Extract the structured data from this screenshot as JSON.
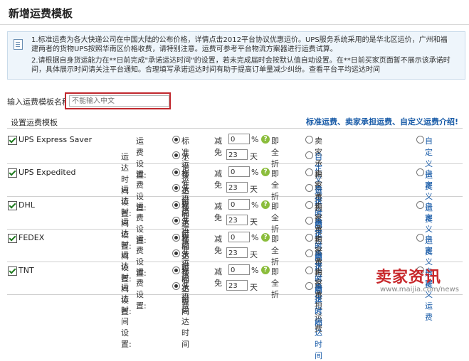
{
  "header": {
    "title": "新增运费模板"
  },
  "notice": {
    "line1": "1.标准运费为各大快递公司在中国大陆的公布价格，详情点击2012平台协议优惠运价。UPS服务系统采用的是华北区运价，广州和福",
    "line2": "建两者的货物UPS按照华南区价格收费，请特别注意。运费可参考平台物流方案器进行运费试算。",
    "line3": "2.请根据自身货运能力在**日前完成\"承诺运达时间\"的设置，若未完成届时会按默认值自动设置。在**日前买家页面暂不展示该承诺时",
    "line4": "间，具体展示时间请关注平台通知。合理填写承诺运达时间有助于提高订单量减少纠纷。查看平台平均运达时间"
  },
  "template_name": {
    "label": "输入运费模板名称",
    "placeholder": "不能输入中文",
    "value": ""
  },
  "settings": {
    "label": "设置运费模板",
    "intro_link": "标准运费、卖家承担运费、自定义运费介绍!"
  },
  "row_labels": {
    "fee_setting": "运费设置:",
    "standard_fee": "标准运费",
    "discount": "减免",
    "percent": "%",
    "full_discount": "即全折",
    "seller_pays": "卖家承担运费",
    "custom_fee": "自定义运费",
    "time_setting": "运达时间设置:",
    "promised_time": "承诺运达时间",
    "days_unit": "天",
    "custom_time": "自定义运达时间"
  },
  "carriers": [
    {
      "name": "UPS Express Saver",
      "discount": "0",
      "days": "23",
      "checked": true
    },
    {
      "name": "UPS Expedited",
      "discount": "0",
      "days": "23",
      "checked": true
    },
    {
      "name": "DHL",
      "discount": "0",
      "days": "23",
      "checked": true
    },
    {
      "name": "FEDEX",
      "discount": "0",
      "days": "23",
      "checked": true
    },
    {
      "name": "TNT",
      "discount": "0",
      "days": "23",
      "checked": true
    }
  ],
  "watermark": {
    "main": "卖家资讯",
    "url": "www.maijia.com/news"
  }
}
